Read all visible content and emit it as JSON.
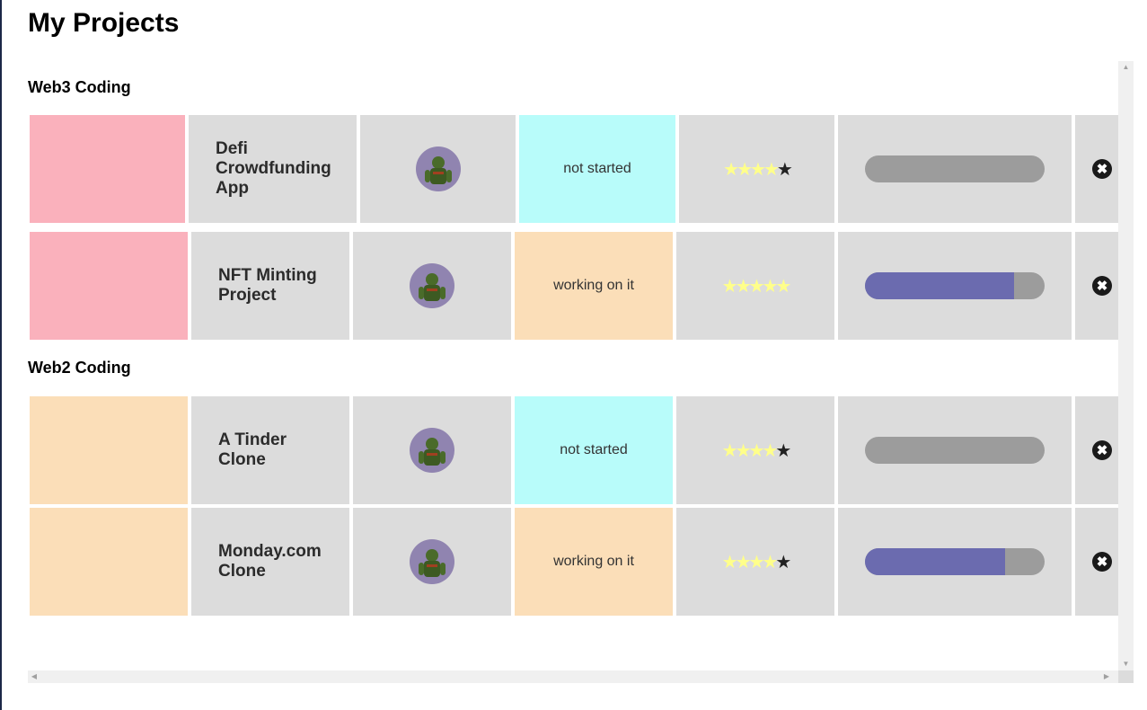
{
  "page": {
    "title": "My Projects"
  },
  "colors": {
    "web3_group": "#fab1bc",
    "web2_group": "#fbdeb8",
    "not_started": "#b8fcfa",
    "working_on_it": "#fbdeb8",
    "progress_fill": "#6b6baf",
    "progress_track": "#9c9c9c"
  },
  "groups": [
    {
      "title": "Web3 Coding",
      "color": "#fab1bc",
      "projects": [
        {
          "name": "Defi Crowdfunding App",
          "status": "not started",
          "status_color": "#b8fcfa",
          "rating": 4,
          "rating_max": 5,
          "progress_percent": 0,
          "avatar_icon": "avatar-image",
          "delete_icon": "close-circle-icon"
        },
        {
          "name": "NFT Minting Project",
          "status": "working on it",
          "status_color": "#fbdeb8",
          "rating": 5,
          "rating_max": 5,
          "progress_percent": 83,
          "avatar_icon": "avatar-image",
          "delete_icon": "close-circle-icon"
        }
      ]
    },
    {
      "title": "Web2 Coding",
      "color": "#fbdeb8",
      "projects": [
        {
          "name": "A Tinder Clone",
          "status": "not started",
          "status_color": "#b8fcfa",
          "rating": 4,
          "rating_max": 5,
          "progress_percent": 0,
          "avatar_icon": "avatar-image",
          "delete_icon": "close-circle-icon"
        },
        {
          "name": "Monday.com Clone",
          "status": "working on it",
          "status_color": "#fbdeb8",
          "rating": 4,
          "rating_max": 5,
          "progress_percent": 78,
          "avatar_icon": "avatar-image",
          "delete_icon": "close-circle-icon"
        }
      ]
    }
  ],
  "icons": {
    "delete": "close-circle-icon",
    "star": "star-icon",
    "delete_glyph": "✖",
    "star_glyph": "★"
  }
}
